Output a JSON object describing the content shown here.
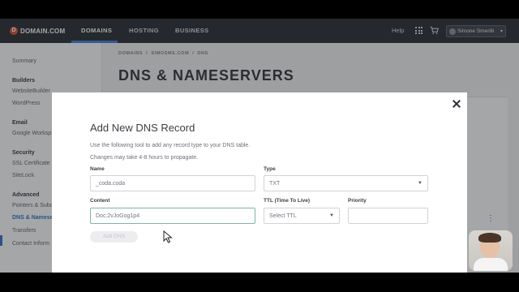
{
  "nav": {
    "logo": "DOMAIN.COM",
    "logo_mark": "D",
    "items": [
      "DOMAINS",
      "HOSTING",
      "BUSINESS"
    ],
    "help": "Help",
    "user": "Simone Smerilli",
    "apps_icon": "grid-icon",
    "cart_icon": "cart-icon"
  },
  "sidebar": {
    "summary": "Summary",
    "sections": [
      {
        "heading": "Builders",
        "items": [
          "WebsiteBuilder",
          "WordPress"
        ]
      },
      {
        "heading": "Email",
        "items": [
          "Google Worksp"
        ]
      },
      {
        "heading": "Security",
        "items": [
          "SSL Certificate",
          "SiteLock"
        ]
      },
      {
        "heading": "Advanced",
        "items": [
          "Pointers & Subd",
          "DNS & Namese",
          "Transfers",
          "Contact Inform"
        ]
      }
    ],
    "active_item": "DNS & Namese"
  },
  "breadcrumb": [
    "DOMAINS",
    "/",
    "SIMOSME.COM",
    "/",
    "DNS"
  ],
  "page_title": "DNS & NAMESERVERS",
  "modal": {
    "title": "Add New DNS Record",
    "desc1": "Use the following tool to add any record type to your DNS table.",
    "desc2": "Changes may take 4-8 hours to propagate.",
    "name_label": "Name",
    "name_value": "_coda.coda",
    "type_label": "Type",
    "type_value": "TXT",
    "content_label": "Content",
    "content_value": "Doc:2vJoGog1p4",
    "ttl_label": "TTL (Time To Live)",
    "ttl_value": "Select TTL",
    "priority_label": "Priority",
    "priority_value": "",
    "add_button": "Add DNS"
  }
}
